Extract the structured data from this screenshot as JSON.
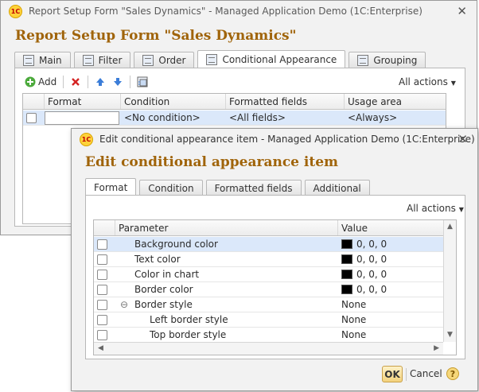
{
  "main_window": {
    "title": "Report Setup Form \"Sales Dynamics\" - Managed Application Demo  (1C:Enterprise)",
    "logo_text": "1C",
    "form_title": "Report Setup Form \"Sales Dynamics\"",
    "tabs": [
      {
        "label": "Main",
        "icon": "form-icon"
      },
      {
        "label": "Filter",
        "icon": "filter-icon"
      },
      {
        "label": "Order",
        "icon": "order-icon"
      },
      {
        "label": "Conditional Appearance",
        "icon": "appearance-icon",
        "active": true
      },
      {
        "label": "Grouping",
        "icon": "grouping-icon"
      }
    ],
    "toolbar": {
      "add_label": "Add",
      "all_actions": "All actions"
    },
    "table": {
      "columns": [
        "Format",
        "Condition",
        "Formatted fields",
        "Usage area"
      ],
      "rows": [
        {
          "format": "",
          "condition": "<No condition>",
          "formatted_fields": "<All fields>",
          "usage_area": "<Always>"
        }
      ]
    }
  },
  "dialog": {
    "title": "Edit conditional appearance item - Managed Application Demo  (1C:Enterprise)",
    "logo_text": "1C",
    "form_title": "Edit conditional appearance item",
    "tabs": [
      "Format",
      "Condition",
      "Formatted fields",
      "Additional"
    ],
    "active_tab": "Format",
    "all_actions": "All actions",
    "table": {
      "columns": [
        "Parameter",
        "Value"
      ],
      "rows": [
        {
          "parameter": "Background color",
          "value": "0, 0, 0",
          "swatch": "#000000",
          "selected": true
        },
        {
          "parameter": "Text color",
          "value": "0, 0, 0",
          "swatch": "#000000"
        },
        {
          "parameter": "Color in chart",
          "value": "0, 0, 0",
          "swatch": "#000000"
        },
        {
          "parameter": "Border color",
          "value": "0, 0, 0",
          "swatch": "#000000"
        },
        {
          "parameter": "Border style",
          "value": "None",
          "expander": "⊖"
        },
        {
          "parameter": "Left border style",
          "value": "None",
          "indent": true
        },
        {
          "parameter": "Top border style",
          "value": "None",
          "indent": true
        }
      ]
    },
    "buttons": {
      "ok": "OK",
      "cancel": "Cancel",
      "help": "?"
    }
  },
  "colors": {
    "title_accent": "#a0640a",
    "selection": "#dbe8fa",
    "ok_button": "#f3d27d"
  }
}
